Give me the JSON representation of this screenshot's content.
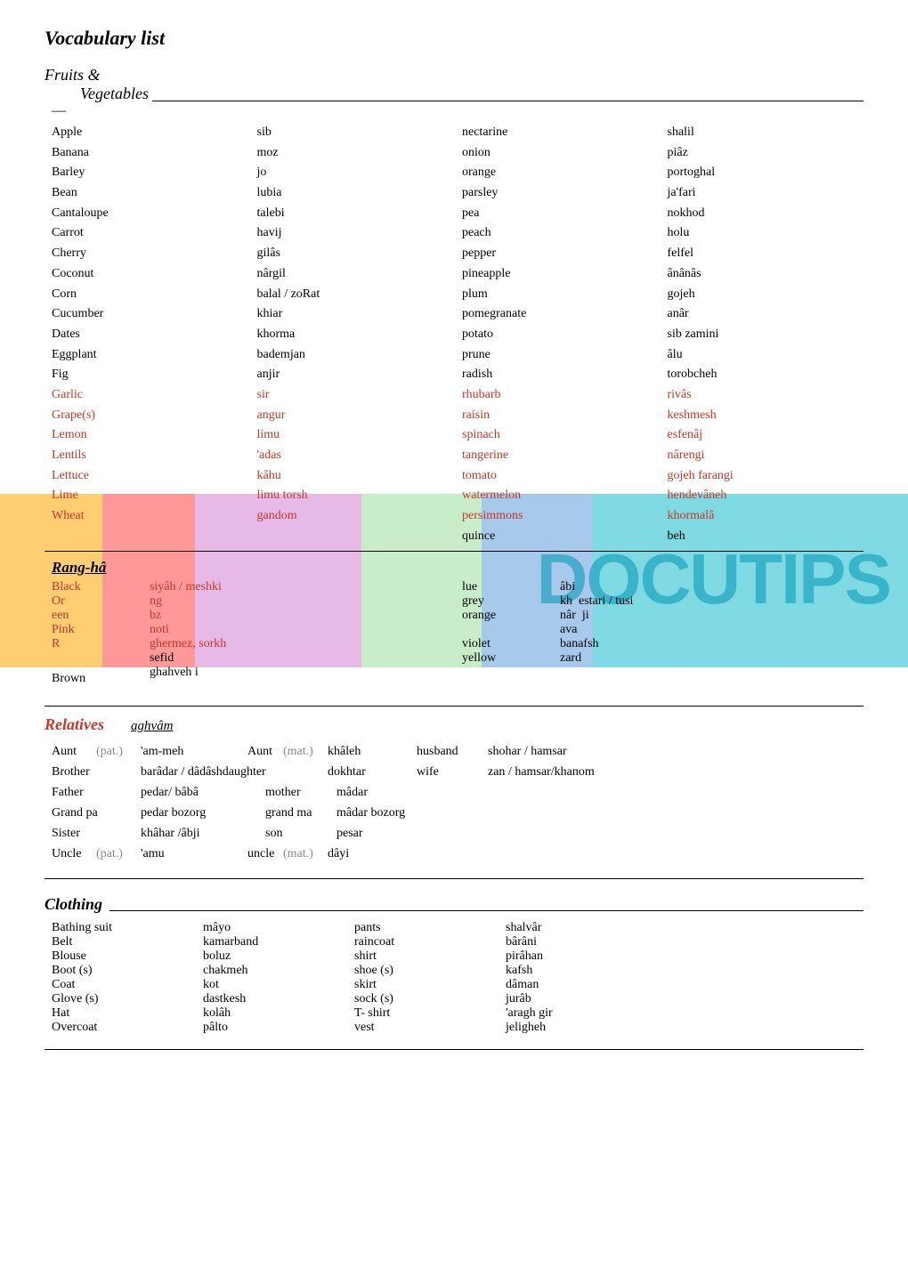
{
  "title": "Vocabulary list",
  "sections": {
    "fruits_vegetables": {
      "header1": "Fruits &",
      "header2": "Vegetables",
      "dash": "—",
      "col1_items": [
        {
          "term": "Apple",
          "highlight": false
        },
        {
          "term": "Banana",
          "highlight": false
        },
        {
          "term": "Barley",
          "highlight": false
        },
        {
          "term": "Bean",
          "highlight": false
        },
        {
          "term": "Cantaloupe",
          "highlight": false
        },
        {
          "term": "Carrot",
          "highlight": false
        },
        {
          "term": "Cherry",
          "highlight": false
        },
        {
          "term": "Coconut",
          "highlight": false
        },
        {
          "term": "Corn",
          "highlight": false
        },
        {
          "term": "Cucumber",
          "highlight": false
        },
        {
          "term": "Dates",
          "highlight": false
        },
        {
          "term": "Eggplant",
          "highlight": false
        },
        {
          "term": "Fig",
          "highlight": false
        },
        {
          "term": "Garlic",
          "highlight": true
        },
        {
          "term": "Grape(s)",
          "highlight": true
        },
        {
          "term": "Lemon",
          "highlight": true
        },
        {
          "term": "Lentils",
          "highlight": true
        },
        {
          "term": "Lettuce",
          "highlight": true
        },
        {
          "term": "Lime",
          "highlight": true
        },
        {
          "term": "Wheat",
          "highlight": true
        }
      ],
      "col2_items": [
        {
          "term": "sib",
          "highlight": false
        },
        {
          "term": "moz",
          "highlight": false
        },
        {
          "term": "jo",
          "highlight": false
        },
        {
          "term": "lubia",
          "highlight": false
        },
        {
          "term": "talebi",
          "highlight": false
        },
        {
          "term": "havij",
          "highlight": false
        },
        {
          "term": "gilâs",
          "highlight": false
        },
        {
          "term": "nârgil",
          "highlight": false
        },
        {
          "term": "balal / zoRat",
          "highlight": false
        },
        {
          "term": "khiar",
          "highlight": false
        },
        {
          "term": "khorma",
          "highlight": false
        },
        {
          "term": "bademjan",
          "highlight": false
        },
        {
          "term": "anjir",
          "highlight": false
        },
        {
          "term": "sir",
          "highlight": true
        },
        {
          "term": "angur",
          "highlight": true
        },
        {
          "term": "limu",
          "highlight": true
        },
        {
          "term": "'adas",
          "highlight": true
        },
        {
          "term": "kâhu",
          "highlight": true
        },
        {
          "term": "limu torsh",
          "highlight": true
        },
        {
          "term": "gandom",
          "highlight": true
        }
      ],
      "col3_items": [
        {
          "term": "nectarine",
          "highlight": false
        },
        {
          "term": "onion",
          "highlight": false
        },
        {
          "term": "orange",
          "highlight": false
        },
        {
          "term": "parsley",
          "highlight": false
        },
        {
          "term": "pea",
          "highlight": false
        },
        {
          "term": "peach",
          "highlight": false
        },
        {
          "term": "pepper",
          "highlight": false
        },
        {
          "term": "pineapple",
          "highlight": false
        },
        {
          "term": "plum",
          "highlight": false
        },
        {
          "term": "pomegranate",
          "highlight": false
        },
        {
          "term": "potato",
          "highlight": false
        },
        {
          "term": "prune",
          "highlight": false
        },
        {
          "term": "radish",
          "highlight": false
        },
        {
          "term": "rhubarb",
          "highlight": true
        },
        {
          "term": "raisin",
          "highlight": true
        },
        {
          "term": "spinach",
          "highlight": true
        },
        {
          "term": "tangerine",
          "highlight": true
        },
        {
          "term": "tomato",
          "highlight": true
        },
        {
          "term": "watermelon",
          "highlight": true
        },
        {
          "term": "persimmons",
          "highlight": true
        },
        {
          "term": "quince",
          "highlight": false
        }
      ],
      "col4_items": [
        {
          "term": "shalil",
          "highlight": false
        },
        {
          "term": "piâz",
          "highlight": false
        },
        {
          "term": "portoghal",
          "highlight": false
        },
        {
          "term": "ja'fari",
          "highlight": false
        },
        {
          "term": "nokhod",
          "highlight": false
        },
        {
          "term": "holu",
          "highlight": false
        },
        {
          "term": "felfel",
          "highlight": false
        },
        {
          "term": "ânânâs",
          "highlight": false
        },
        {
          "term": "gojeh",
          "highlight": false
        },
        {
          "term": "anâr",
          "highlight": false
        },
        {
          "term": "sib zamini",
          "highlight": false
        },
        {
          "term": "âlu",
          "highlight": false
        },
        {
          "term": "torobcheh",
          "highlight": false
        },
        {
          "term": "rivâs",
          "highlight": true
        },
        {
          "term": "keshmesh",
          "highlight": true
        },
        {
          "term": "esfenâj",
          "highlight": true
        },
        {
          "term": "nârengi",
          "highlight": true
        },
        {
          "term": "gojeh farangi",
          "highlight": true
        },
        {
          "term": "hendevâneh",
          "highlight": true
        },
        {
          "term": "khormalâ",
          "highlight": true
        },
        {
          "term": "beh",
          "highlight": false
        }
      ]
    },
    "colors": {
      "header": "Rang-hâ",
      "col1": [
        {
          "term": "Black",
          "highlight": true
        },
        {
          "term": "Or",
          "highlight": true
        },
        {
          "term": "een",
          "highlight": true
        },
        {
          "term": "Pink",
          "highlight": true
        },
        {
          "term": "R",
          "highlight": true
        },
        {
          "term": "",
          "highlight": false
        },
        {
          "term": "Brown",
          "highlight": false
        }
      ],
      "col1_trans": [
        {
          "term": "siyâh / meshki",
          "highlight": true
        },
        {
          "term": "ng",
          "highlight": true
        },
        {
          "term": "bz",
          "highlight": true
        },
        {
          "term": "noti",
          "highlight": true
        },
        {
          "term": "ghermez, sorkh",
          "highlight": true
        },
        {
          "term": "sefid",
          "highlight": false
        },
        {
          "term": "ghahveh i",
          "highlight": false
        }
      ],
      "col2": [
        {
          "term": "lue",
          "highlight": false
        },
        {
          "term": "grey",
          "highlight": false
        },
        {
          "term": "orange",
          "highlight": false
        },
        {
          "term": "",
          "highlight": false
        },
        {
          "term": "violet",
          "highlight": false
        },
        {
          "term": "yellow",
          "highlight": false
        }
      ],
      "col2_trans": [
        {
          "term": "âbi",
          "highlight": false
        },
        {
          "term": "kh  estari / tusi",
          "highlight": false
        },
        {
          "term": "nâr ji",
          "highlight": false
        },
        {
          "term": "ava",
          "highlight": false
        },
        {
          "term": "banafsh",
          "highlight": false
        },
        {
          "term": "zard",
          "highlight": false
        }
      ]
    },
    "relatives": {
      "header": "Relatives",
      "subheader": "aghvâm",
      "rows": [
        {
          "term": "Aunt",
          "qualifier": "(pat.)",
          "trans_label": "'am-meh",
          "term2": "Aunt",
          "qualifier2": "(mat.)",
          "trans2": "khâleh",
          "term3": "husband",
          "trans3": "shohar / hamsar"
        },
        {
          "term": "Brother",
          "qualifier": "",
          "trans_label": "barâdar / dâdâshdaughter",
          "term2": "",
          "qualifier2": "",
          "trans2": "dokhtar",
          "term3": "wife",
          "trans3": "zan / hamsar/khanom"
        },
        {
          "term": "Father",
          "qualifier": "",
          "trans_label": "pedar/ bâbâ",
          "term2": "mother",
          "qualifier2": "",
          "trans2": "mâdar",
          "term3": "",
          "trans3": ""
        },
        {
          "term": "Grand pa",
          "qualifier": "",
          "trans_label": "pedar bozorg",
          "term2": "grand ma",
          "qualifier2": "",
          "trans2": "mâdar bozorg",
          "term3": "",
          "trans3": ""
        },
        {
          "term": "Sister",
          "qualifier": "",
          "trans_label": "khâhar /âbji",
          "term2": "son",
          "qualifier2": "",
          "trans2": "pesar",
          "term3": "",
          "trans3": ""
        },
        {
          "term": "Uncle",
          "qualifier": "(pat.)",
          "trans_label": "'amu",
          "term2": "uncle",
          "qualifier2": "(mat.)",
          "trans2": "dâyi",
          "term3": "",
          "trans3": ""
        }
      ]
    },
    "clothing": {
      "header": "Clothing",
      "col1": [
        {
          "term": "Bathing suit",
          "trans": "mâyo"
        },
        {
          "term": "Belt",
          "trans": "kamarband"
        },
        {
          "term": "Blouse",
          "trans": "boluz"
        },
        {
          "term": "Boot (s)",
          "trans": "chakmeh"
        },
        {
          "term": "Coat",
          "trans": "kot"
        },
        {
          "term": "Glove (s)",
          "trans": "dastkesh"
        },
        {
          "term": "Hat",
          "trans": "kolâh"
        },
        {
          "term": "Overcoat",
          "trans": "pâlto"
        }
      ],
      "col2": [
        {
          "term": "pants",
          "trans": "shalvâr"
        },
        {
          "term": "raincoat",
          "trans": "bârâni"
        },
        {
          "term": "shirt",
          "trans": "pirâhan"
        },
        {
          "term": "shoe (s)",
          "trans": "kafsh"
        },
        {
          "term": "skirt",
          "trans": "dâman"
        },
        {
          "term": "sock (s)",
          "trans": "jurâb"
        },
        {
          "term": "T- shirt",
          "trans": "'aragh gir"
        },
        {
          "term": "vest",
          "trans": "jeligheh"
        }
      ]
    }
  }
}
